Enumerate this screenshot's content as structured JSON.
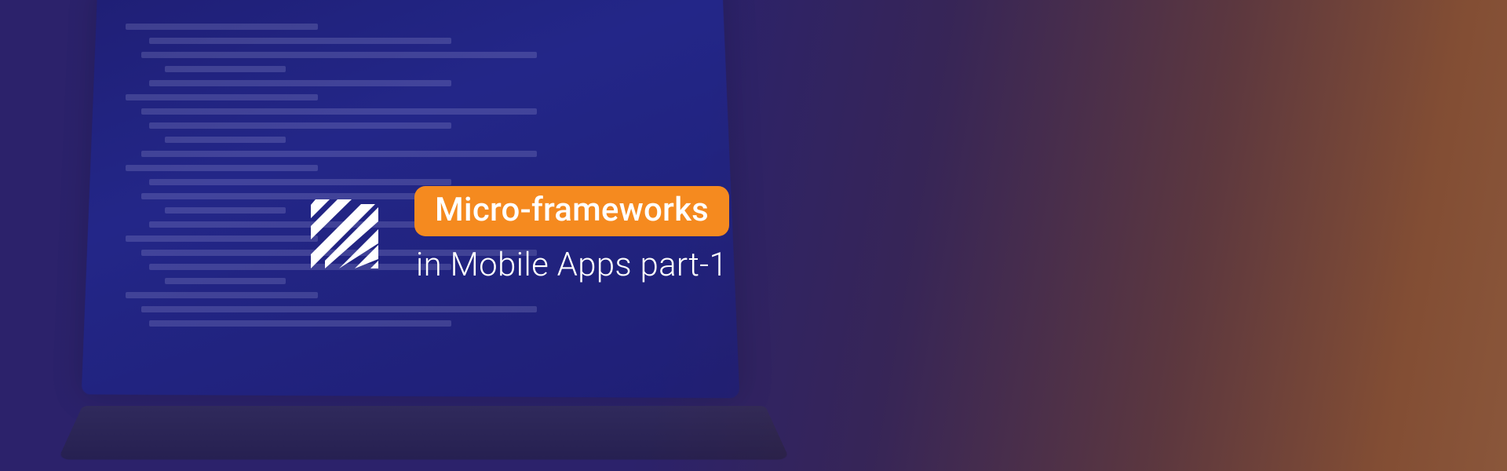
{
  "banner": {
    "highlight": "Micro-frameworks",
    "subtitle": "in Mobile Apps part-1"
  },
  "colors": {
    "accent_orange": "#f58a1f",
    "overlay_purple": "#2d236e",
    "text_white": "#ffffff"
  },
  "icon": {
    "name": "diagonal-stripes-logo"
  }
}
